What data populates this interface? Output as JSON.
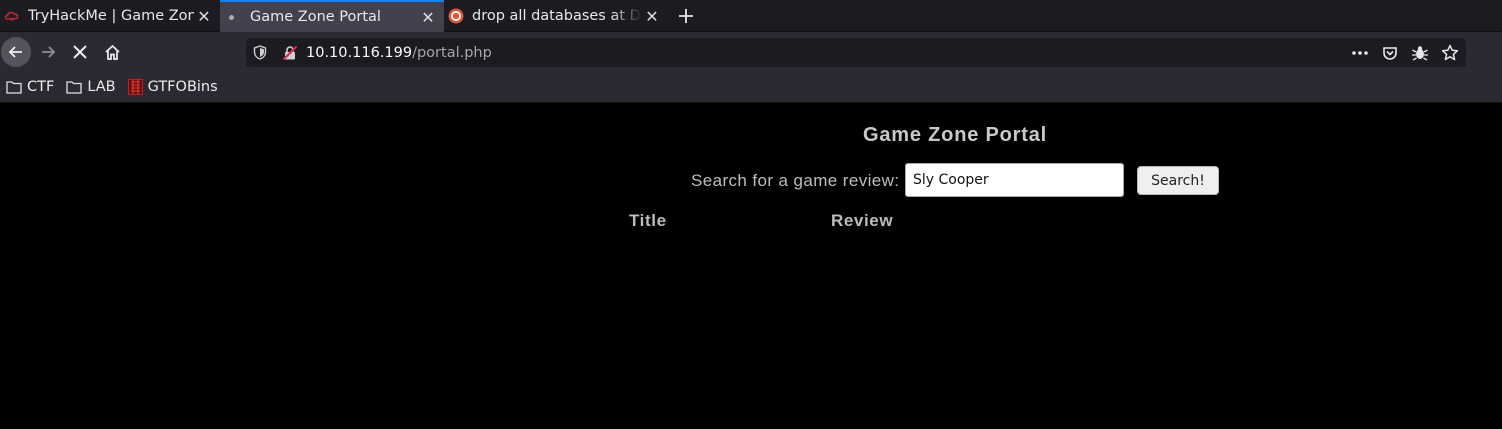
{
  "browser": {
    "tabs": [
      {
        "title": "TryHackMe | Game Zone",
        "favicon": "tryhackme-icon",
        "active": false
      },
      {
        "title": "Game Zone Portal",
        "favicon": "loading-dot-icon",
        "active": true
      },
      {
        "title": "drop all databases at DuckDuckGo",
        "favicon": "duckduckgo-icon",
        "active": false
      }
    ],
    "url": {
      "host": "10.10.116.199",
      "path": "/portal.php"
    },
    "bookmarks": [
      {
        "label": "CTF",
        "icon": "folder-icon"
      },
      {
        "label": "LAB",
        "icon": "folder-icon"
      },
      {
        "label": "GTFOBins",
        "icon": "gtfobins-icon"
      }
    ]
  },
  "portal": {
    "title": "Game Zone Portal",
    "search_label": "Search for a game review:",
    "search_value": "Sly Cooper",
    "search_button": "Search!",
    "columns": [
      "Title",
      "Review"
    ]
  },
  "colors": {
    "tab_strip": "#1c1b22",
    "toolbar": "#2b2a33",
    "active_tab": "#42414d",
    "accent": "#0a84ff",
    "page_bg": "#000000",
    "page_text": "#bdbdbd"
  }
}
